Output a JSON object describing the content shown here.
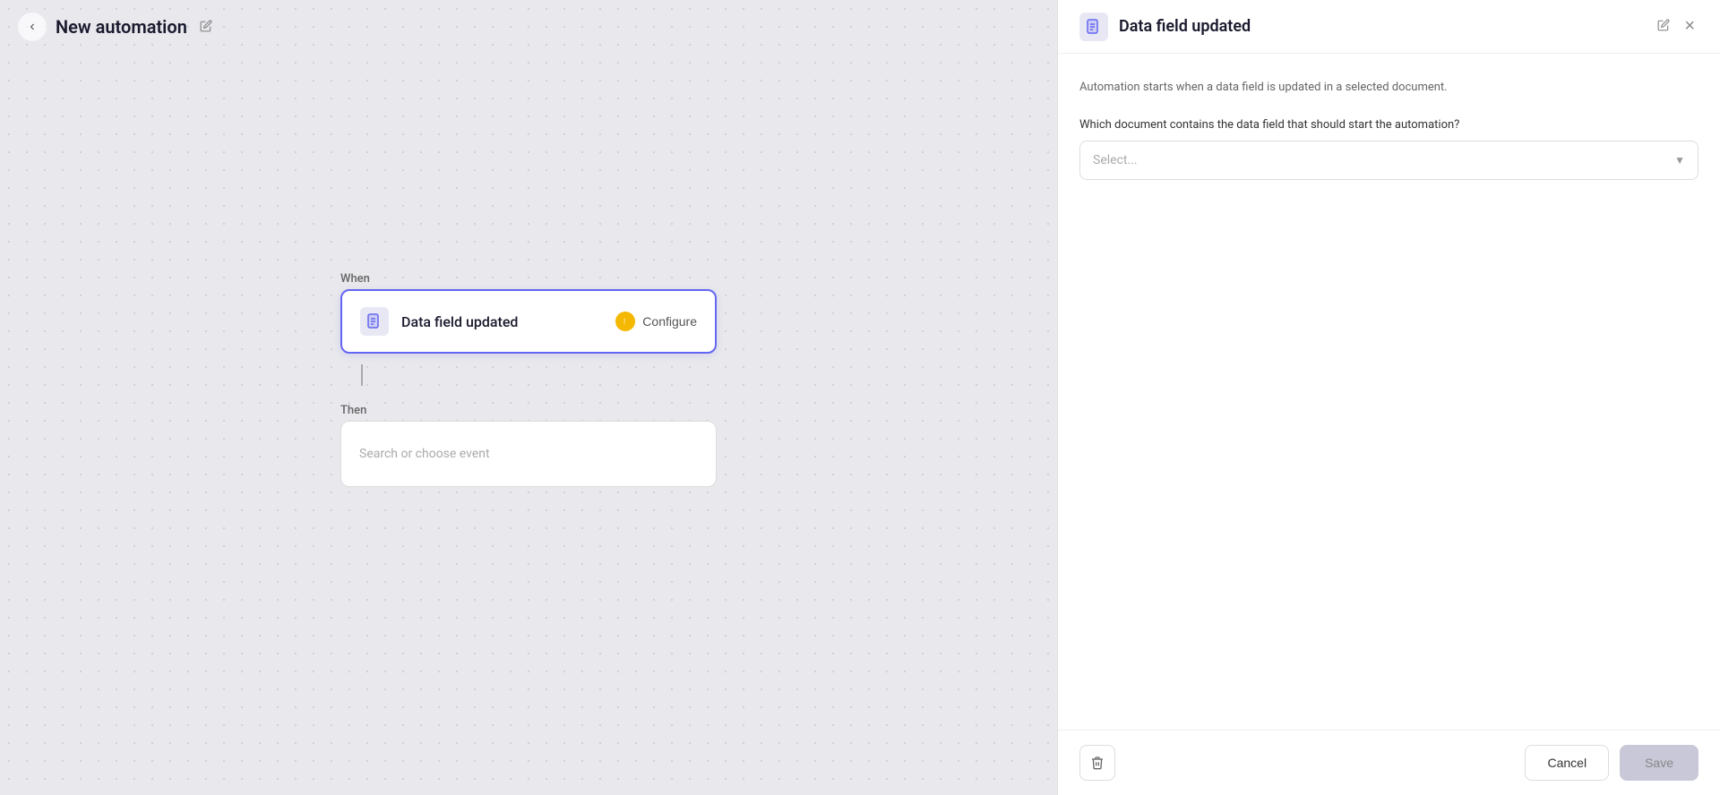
{
  "header": {
    "back_label": "←",
    "title": "New automation",
    "edit_icon": "✏️"
  },
  "canvas": {
    "when_label": "When",
    "then_label": "Then",
    "trigger": {
      "name": "Data field updated",
      "configure_label": "Configure",
      "doc_icon": "📄"
    },
    "event_placeholder": "Search or choose event"
  },
  "sidebar": {
    "title": "Data field updated",
    "edit_icon": "✏️",
    "close_icon": "×",
    "doc_icon": "📄",
    "description": "Automation starts when a data field is updated in a selected document.",
    "field_label": "Which document contains the data field that should start the automation?",
    "select_placeholder": "Select...",
    "chevron": "▼"
  },
  "footer": {
    "delete_icon": "🗑",
    "cancel_label": "Cancel",
    "save_label": "Save"
  }
}
